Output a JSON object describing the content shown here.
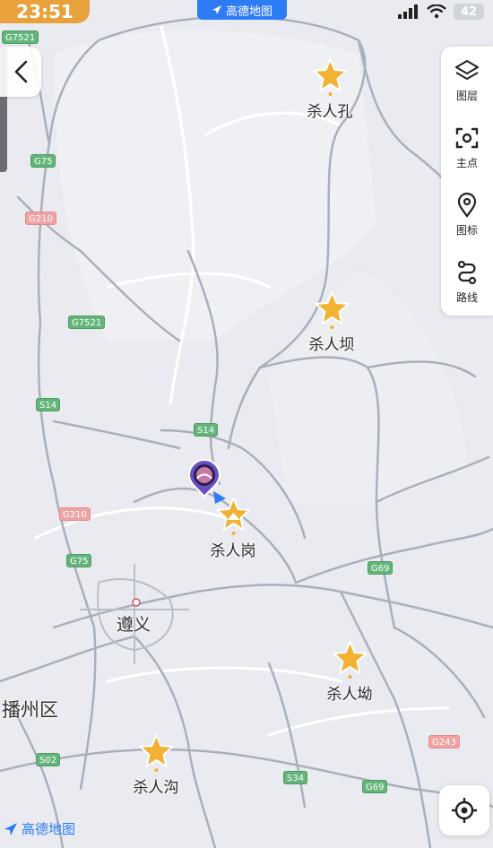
{
  "status_bar": {
    "time": "23:51",
    "battery": "42"
  },
  "app": {
    "name": "高德地图"
  },
  "colors": {
    "accent": "#2e7bf6",
    "time_badge": "#e9a23b",
    "poi_star": "#f2b233"
  },
  "toolbar": {
    "items": [
      {
        "label": "图层",
        "icon": "layers-icon"
      },
      {
        "label": "主点",
        "icon": "scan-icon"
      },
      {
        "label": "图标",
        "icon": "pin-icon"
      },
      {
        "label": "路线",
        "icon": "route-icon"
      }
    ]
  },
  "pois": [
    {
      "label": "杀人孔",
      "type": "star"
    },
    {
      "label": "杀人坝",
      "type": "star"
    },
    {
      "label": "杀人岗",
      "type": "scenic"
    },
    {
      "label": "杀人坳",
      "type": "star"
    },
    {
      "label": "杀人沟",
      "type": "star"
    }
  ],
  "places": {
    "city": "遵义",
    "district": "播州区"
  },
  "road_shields": [
    "G7521",
    "G75",
    "G210",
    "G7521",
    "S14",
    "S14",
    "G210",
    "G75",
    "G69",
    "S02",
    "S34",
    "G69",
    "G243"
  ],
  "watermark": "高德地图"
}
